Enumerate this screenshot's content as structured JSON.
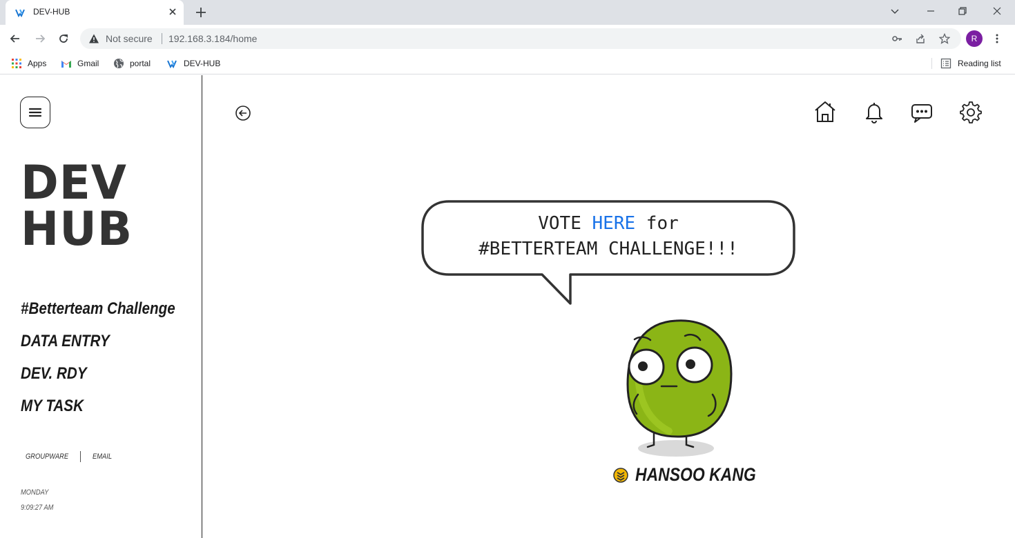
{
  "browser": {
    "tab_title": "DEV-HUB",
    "security_label": "Not secure",
    "url": "192.168.3.184/home",
    "profile_initial": "R",
    "bookmarks": [
      {
        "label": "Apps",
        "icon": "apps-grid-icon"
      },
      {
        "label": "Gmail",
        "icon": "gmail-icon"
      },
      {
        "label": "portal",
        "icon": "globe-icon"
      },
      {
        "label": "DEV-HUB",
        "icon": "devhub-favicon-icon"
      }
    ],
    "reading_list_label": "Reading list"
  },
  "sidebar": {
    "logo_line1": "DEV",
    "logo_line2": "HUB",
    "nav": [
      {
        "label": "#Betterteam Challenge"
      },
      {
        "label": "DATA ENTRY"
      },
      {
        "label": "DEV. RDY"
      },
      {
        "label": "MY TASK"
      }
    ],
    "footer": {
      "groupware": "GROUPWARE",
      "email": "EMAIL"
    },
    "clock": {
      "day": "MONDAY",
      "time": "9:09:27 AM"
    }
  },
  "main": {
    "bubble": {
      "line1_pre": "VOTE ",
      "line1_link": "HERE",
      "line1_post": " for",
      "line2": "#BETTERTEAM CHALLENGE!!!"
    },
    "user_name": "HANSOO KANG",
    "colors": {
      "link": "#1a73e8",
      "character_green": "#8bb516"
    }
  }
}
